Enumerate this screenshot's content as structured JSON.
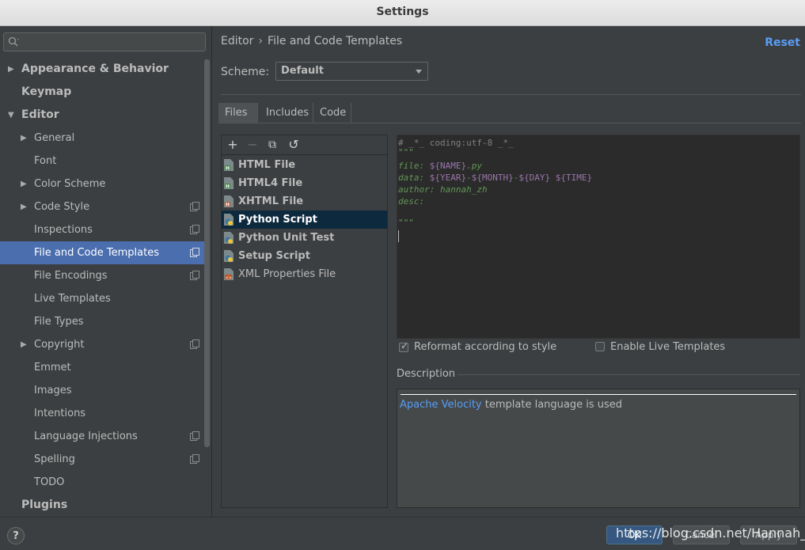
{
  "window": {
    "title": "Settings"
  },
  "search": {
    "placeholder": "",
    "icon": "search-icon"
  },
  "sidebar": {
    "items": [
      {
        "label": "Appearance & Behavior",
        "bold": true,
        "arrow": "right"
      },
      {
        "label": "Keymap",
        "bold": true
      },
      {
        "label": "Editor",
        "bold": true,
        "arrow": "down"
      },
      {
        "label": "General",
        "arrow": "right"
      },
      {
        "label": "Font"
      },
      {
        "label": "Color Scheme",
        "arrow": "right"
      },
      {
        "label": "Code Style",
        "arrow": "right",
        "copy": true
      },
      {
        "label": "Inspections",
        "copy": true
      },
      {
        "label": "File and Code Templates",
        "copy": true,
        "selected": true
      },
      {
        "label": "File Encodings",
        "copy": true
      },
      {
        "label": "Live Templates"
      },
      {
        "label": "File Types"
      },
      {
        "label": "Copyright",
        "arrow": "right",
        "copy": true
      },
      {
        "label": "Emmet"
      },
      {
        "label": "Images"
      },
      {
        "label": "Intentions"
      },
      {
        "label": "Language Injections",
        "copy": true
      },
      {
        "label": "Spelling",
        "copy": true
      },
      {
        "label": "TODO"
      },
      {
        "label": "Plugins",
        "bold": true
      }
    ]
  },
  "header": {
    "breadcrumb": [
      "Editor",
      "File and Code Templates"
    ],
    "separator": "›",
    "reset": "Reset"
  },
  "scheme": {
    "label": "Scheme:",
    "value": "Default"
  },
  "tabs": [
    "Files",
    "Includes",
    "Code"
  ],
  "toolbar": {
    "add": "+",
    "remove": "−",
    "copy": "⧉",
    "revert": "↺"
  },
  "templates": [
    {
      "label": "HTML File",
      "bold": true,
      "icon": "html-file-icon"
    },
    {
      "label": "HTML4 File",
      "bold": true,
      "icon": "html4-file-icon"
    },
    {
      "label": "XHTML File",
      "bold": true,
      "icon": "xhtml-file-icon"
    },
    {
      "label": "Python Script",
      "bold": true,
      "selected": true,
      "icon": "python-file-icon"
    },
    {
      "label": "Python Unit Test",
      "bold": true,
      "icon": "python-file-icon"
    },
    {
      "label": "Setup Script",
      "bold": true,
      "icon": "python-file-icon"
    },
    {
      "label": "XML Properties File",
      "bold": false,
      "icon": "xml-file-icon"
    }
  ],
  "editor": {
    "line1": "# _*_ coding:utf-8 _*_",
    "line2": "\"\"\"",
    "file_key": "file:",
    "file_var": "${NAME}",
    "file_ext": ".py",
    "data_key": "data:",
    "data_y": "${YEAR}",
    "dash1": "-",
    "data_m": "${MONTH}",
    "dash2": "-",
    "data_d": "${DAY}",
    "data_t": "${TIME}",
    "author": "author: hannah_zh",
    "desc": "desc:",
    "close": "\"\"\""
  },
  "options": {
    "reformat": {
      "label": "Reformat according to style",
      "checked": true
    },
    "live": {
      "label": "Enable Live Templates",
      "checked": false
    }
  },
  "description": {
    "label": "Description",
    "link": "Apache Velocity",
    "text": " template language is used"
  },
  "footer": {
    "help": "?",
    "ok": "OK",
    "cancel": "Cancel",
    "apply": "Apply",
    "watermark": "https://blog.csdn.net/Hannah_zh"
  },
  "colors": {
    "selection": "#4b6eaf",
    "link": "#589df6",
    "list_selection": "#0d293e"
  }
}
